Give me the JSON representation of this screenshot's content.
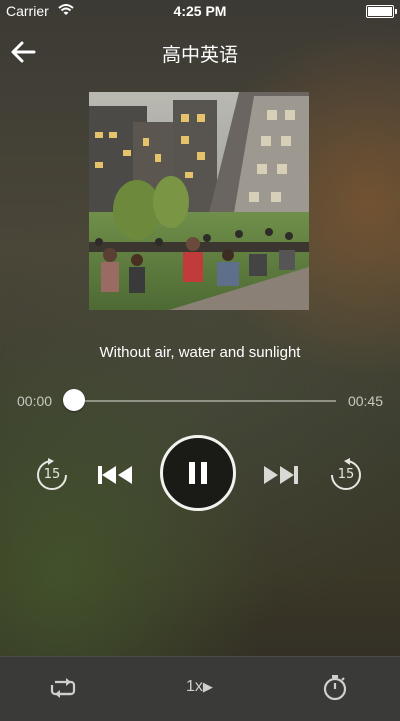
{
  "status_bar": {
    "carrier": "Carrier",
    "time": "4:25 PM"
  },
  "header": {
    "title": "高中英语",
    "back_icon": "back-arrow-icon"
  },
  "track": {
    "title": "Without air, water and sunlight"
  },
  "progress": {
    "current_time": "00:00",
    "duration": "00:45",
    "position_fraction": 0.0
  },
  "controls": {
    "rewind_seconds": "15",
    "forward_seconds": "15",
    "icons": [
      "rewind-15-icon",
      "previous-track-icon",
      "pause-icon",
      "next-track-icon",
      "forward-15-icon"
    ]
  },
  "bottom_bar": {
    "repeat_icon": "repeat-icon",
    "speed_label": "1x",
    "speed_arrow": "▶",
    "timer_icon": "stopwatch-icon"
  }
}
